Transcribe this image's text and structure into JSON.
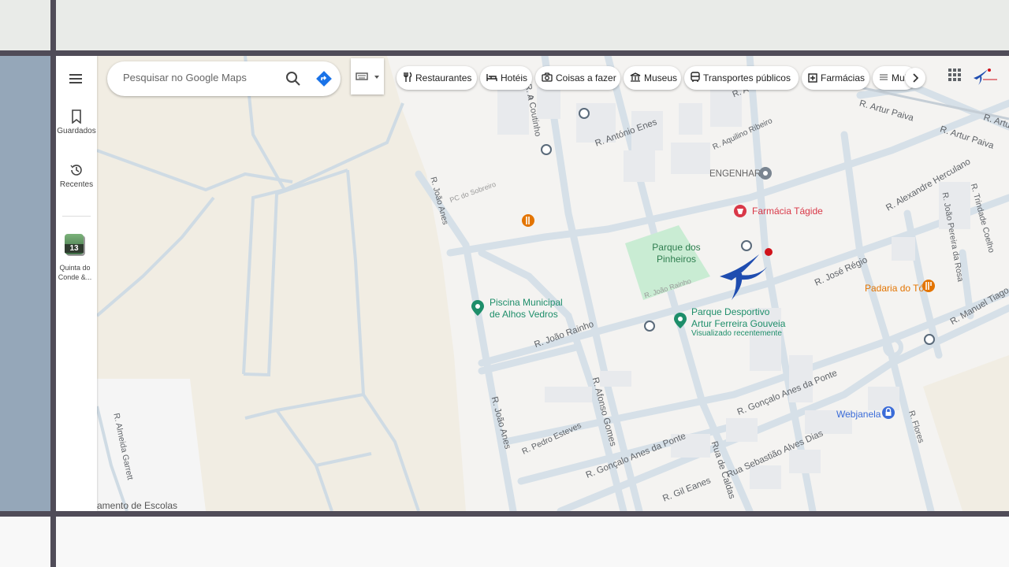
{
  "search": {
    "placeholder": "Pesquisar no Google Maps"
  },
  "rail": {
    "menu_icon": "menu-icon",
    "saved_label": "Guardados",
    "recent_label": "Recentes",
    "recent_place_label": "Quinta do Conde &...",
    "recent_place_badge": "13"
  },
  "chips": [
    {
      "label": "Restaurantes",
      "icon": "fork-knife-icon"
    },
    {
      "label": "Hotéis",
      "icon": "bed-icon"
    },
    {
      "label": "Coisas a fazer",
      "icon": "camera-icon"
    },
    {
      "label": "Museus",
      "icon": "museum-icon"
    },
    {
      "label": "Transportes públicos",
      "icon": "bus-icon"
    },
    {
      "label": "Farmácias",
      "icon": "pharmacy-icon"
    },
    {
      "label": "Mul",
      "icon": "atm-icon"
    }
  ],
  "map": {
    "streets": [
      "R. António Enes",
      "R. Aquilino Ribeiro",
      "R. Artur Paiva",
      "R. Artur Paiva",
      "R. Artur",
      "R. Alexandre Herculano",
      "R. João Pereira da Rosa",
      "R. Trindade Coelho",
      "R. José Régio",
      "R. Manuel Tiago",
      "R. João Anes",
      "R. João Anes",
      "R. João Rainho",
      "R. João Rainho",
      "R. Afonso Gomes",
      "R. Pedro Esteves",
      "R. Gonçalo Anes da Ponte",
      "R. Gonçalo Anes da Ponte",
      "Rua Sebastião Alves Dias",
      "R. Gil Eanes",
      "Rua de Caldas",
      "R. Flores",
      "R. Almeida Garrett",
      "PC do Sobreiro",
      "o Coutinho",
      "R. A",
      "R. A"
    ],
    "places": {
      "engenhar": "ENGENHAR",
      "farmacia": "Farmácia Tágide",
      "parque_pinheiros": "Parque dos Pinheiros",
      "piscina": "Piscina Municipal de Alhos Vedros",
      "parque_desportivo": "Parque Desportivo Artur Ferreira Gouveia",
      "visited": "Visualizado recentemente",
      "padaria": "Padaria do Tó",
      "webjanela": "Webjanela",
      "escolas": "amento de Escolas"
    }
  },
  "colors": {
    "slide_bg": "#e9ebe8",
    "frame": "#504c58",
    "left_panel": "#95a7b9",
    "map_bg": "#f4f3f1",
    "map_land": "#f1ede3",
    "road": "#cfdbe4",
    "park": "#c9ecd3",
    "poi_green": "#1e8e6a",
    "poi_red": "#d93848",
    "poi_orange": "#e37400"
  }
}
